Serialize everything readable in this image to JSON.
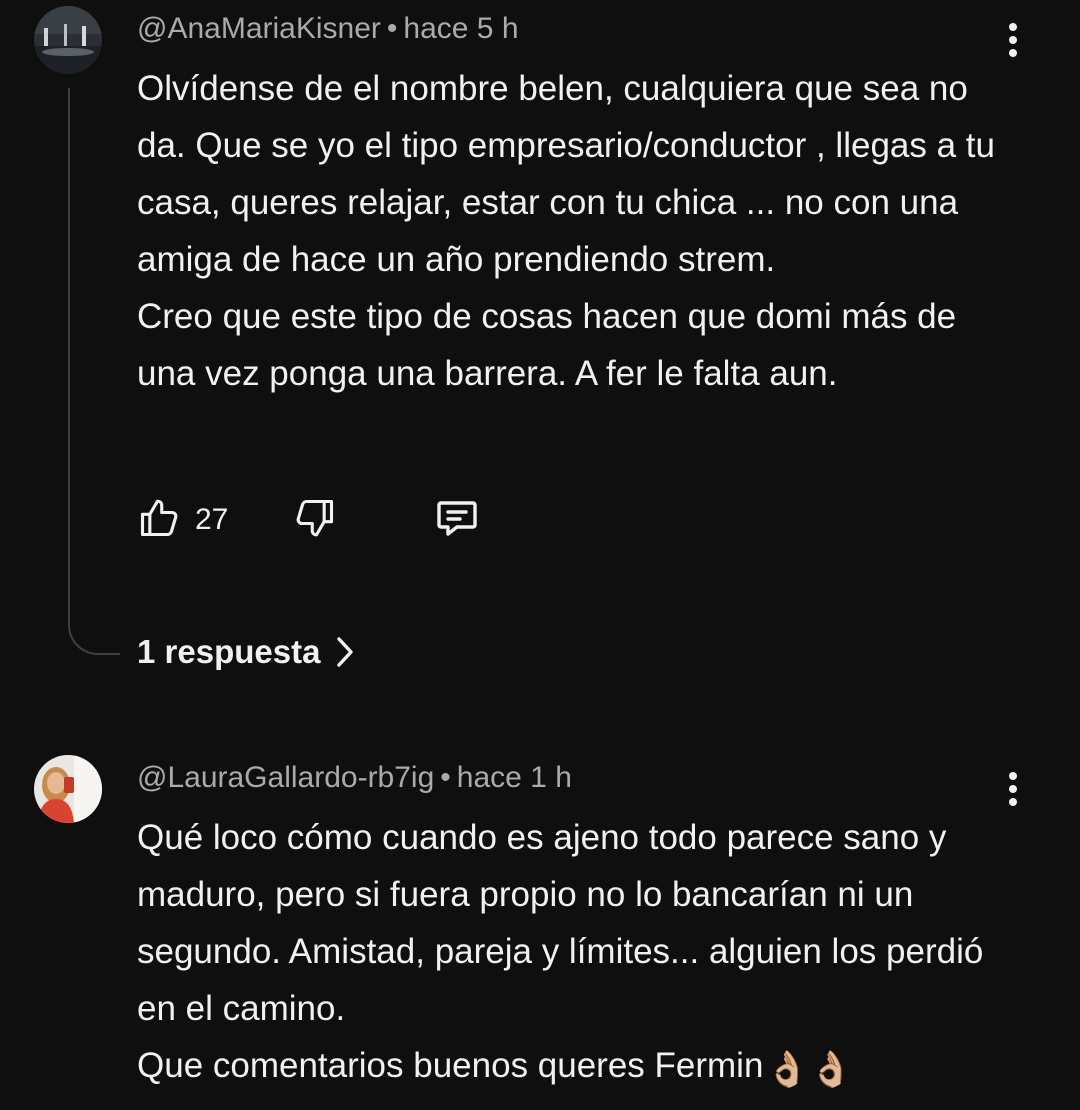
{
  "comments": [
    {
      "author": "@AnaMariaKisner",
      "time": "hace 5 h",
      "lines": [
        "Olvídense de el nombre belen, cualquiera que sea no da. Que se yo el tipo empresario/conductor , llegas a tu casa, queres relajar, estar con tu chica ... no con una amiga de hace un año prendiendo strem.",
        "Creo que este tipo de cosas hacen que domi más de una vez ponga una barrera. A fer le falta aun."
      ],
      "likes": "27",
      "replies_label": "1 respuesta"
    },
    {
      "author": "@LauraGallardo-rb7ig",
      "time": "hace 1 h",
      "lines": [
        "Qué loco cómo cuando es ajeno todo parece sano y maduro, pero si fuera propio no lo bancarían ni un segundo. Amistad, pareja y límites... alguien los perdió en el camino.",
        "Que comentarios buenos queres Fermin"
      ],
      "emoji": "👌🏼👌🏼"
    }
  ],
  "icons": [
    "more-vert-icon",
    "thumb-up-icon",
    "thumb-down-icon",
    "reply-comment-icon",
    "chevron-right-icon"
  ],
  "colors": {
    "background": "#0f0f0f",
    "text": "#f1f1f1",
    "meta": "#aaaaaa",
    "thread": "#3f3f3f"
  }
}
